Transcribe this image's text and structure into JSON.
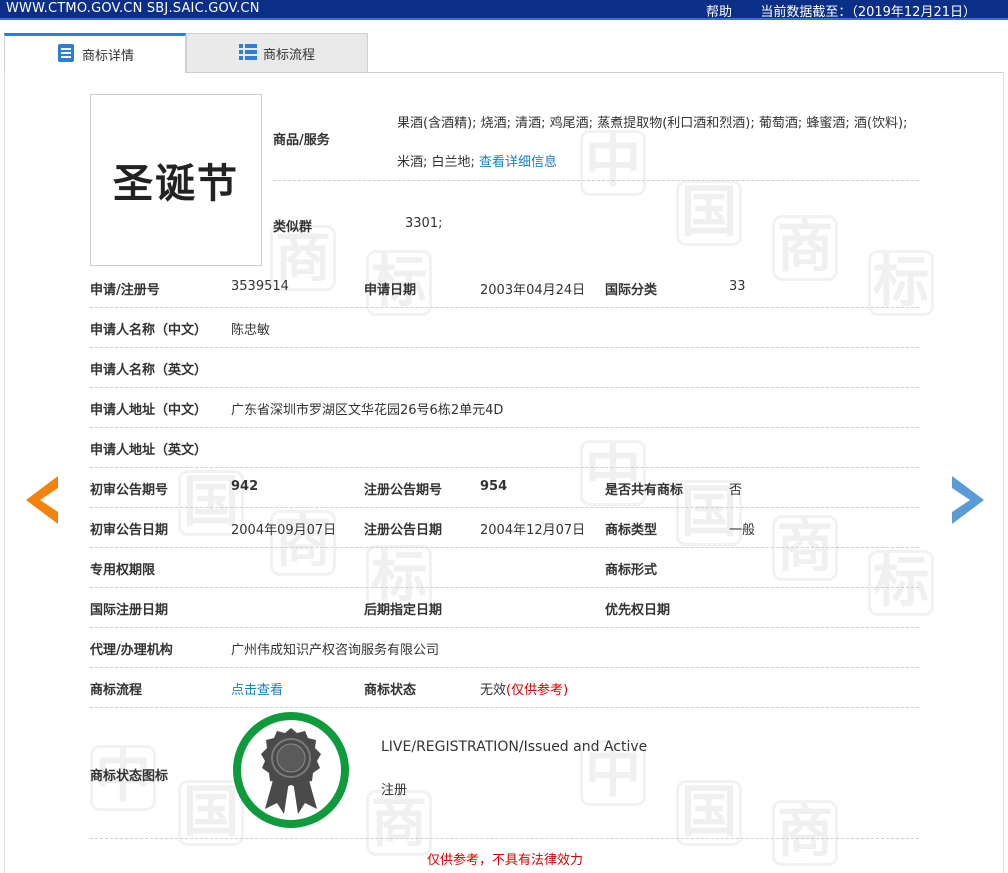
{
  "topbar": {
    "site": "WWW.CTMO.GOV.CN SBJ.SAIC.GOV.CN",
    "help": "帮助",
    "date": "当前数据截至：（2019年12月21日）"
  },
  "tabs": [
    {
      "label": "商标详情",
      "active": true
    },
    {
      "label": "商标流程",
      "active": false
    }
  ],
  "mark": {
    "text": "圣诞节"
  },
  "goods": {
    "label": "商品/服务",
    "value": "果酒(含酒精); 烧酒; 清酒; 鸡尾酒; 蒸煮提取物(利口酒和烈酒); 葡萄酒; 蜂蜜酒; 酒(饮料); 米酒; 白兰地;",
    "link": "查看详细信息"
  },
  "similar": {
    "label": "类似群",
    "value": "3301;"
  },
  "fields": {
    "reg_no_label": "申请/注册号",
    "reg_no": "3539514",
    "app_date_label": "申请日期",
    "app_date": "2003年04月24日",
    "intl_class_label": "国际分类",
    "intl_class": "33",
    "applicant_cn_label": "申请人名称（中文）",
    "applicant_cn": "陈忠敏",
    "applicant_en_label": "申请人名称（英文）",
    "applicant_en": "",
    "address_cn_label": "申请人地址（中文）",
    "address_cn": "广东省深圳市罗湖区文华花园26号6栋2单元4D",
    "address_en_label": "申请人地址（英文）",
    "address_en": "",
    "prelim_issue_label": "初审公告期号",
    "prelim_issue": "942",
    "reg_issue_label": "注册公告期号",
    "reg_issue": "954",
    "shared_label": "是否共有商标",
    "shared": "否",
    "prelim_date_label": "初审公告日期",
    "prelim_date": "2004年09月07日",
    "reg_date_label": "注册公告日期",
    "reg_date": "2004年12月07日",
    "type_label": "商标类型",
    "type": "一般",
    "term_label": "专用权期限",
    "term": "",
    "form_label": "商标形式",
    "form": "",
    "intl_reg_date_label": "国际注册日期",
    "intl_reg_date": "",
    "later_date_label": "后期指定日期",
    "later_date": "",
    "priority_date_label": "优先权日期",
    "priority_date": "",
    "agent_label": "代理/办理机构",
    "agent": "广州伟成知识产权咨询服务有限公司",
    "flow_label": "商标流程",
    "flow_link": "点击查看",
    "status_label": "商标状态",
    "status": "无效",
    "status_note": "(仅供参考)",
    "status_icon_label": "商标状态图标",
    "status_en": "LIVE/REGISTRATION/Issued and Active",
    "status_cn": "注册"
  },
  "footer_note": "仅供参考，不具有法律效力",
  "colors": {
    "topbar": "#0b2f86",
    "link": "#1a7fc1",
    "warning": "#d60000",
    "prev_arrow": "#f5820a",
    "next_arrow": "#5b9bd5",
    "seal_ring": "#0f9a3c"
  }
}
